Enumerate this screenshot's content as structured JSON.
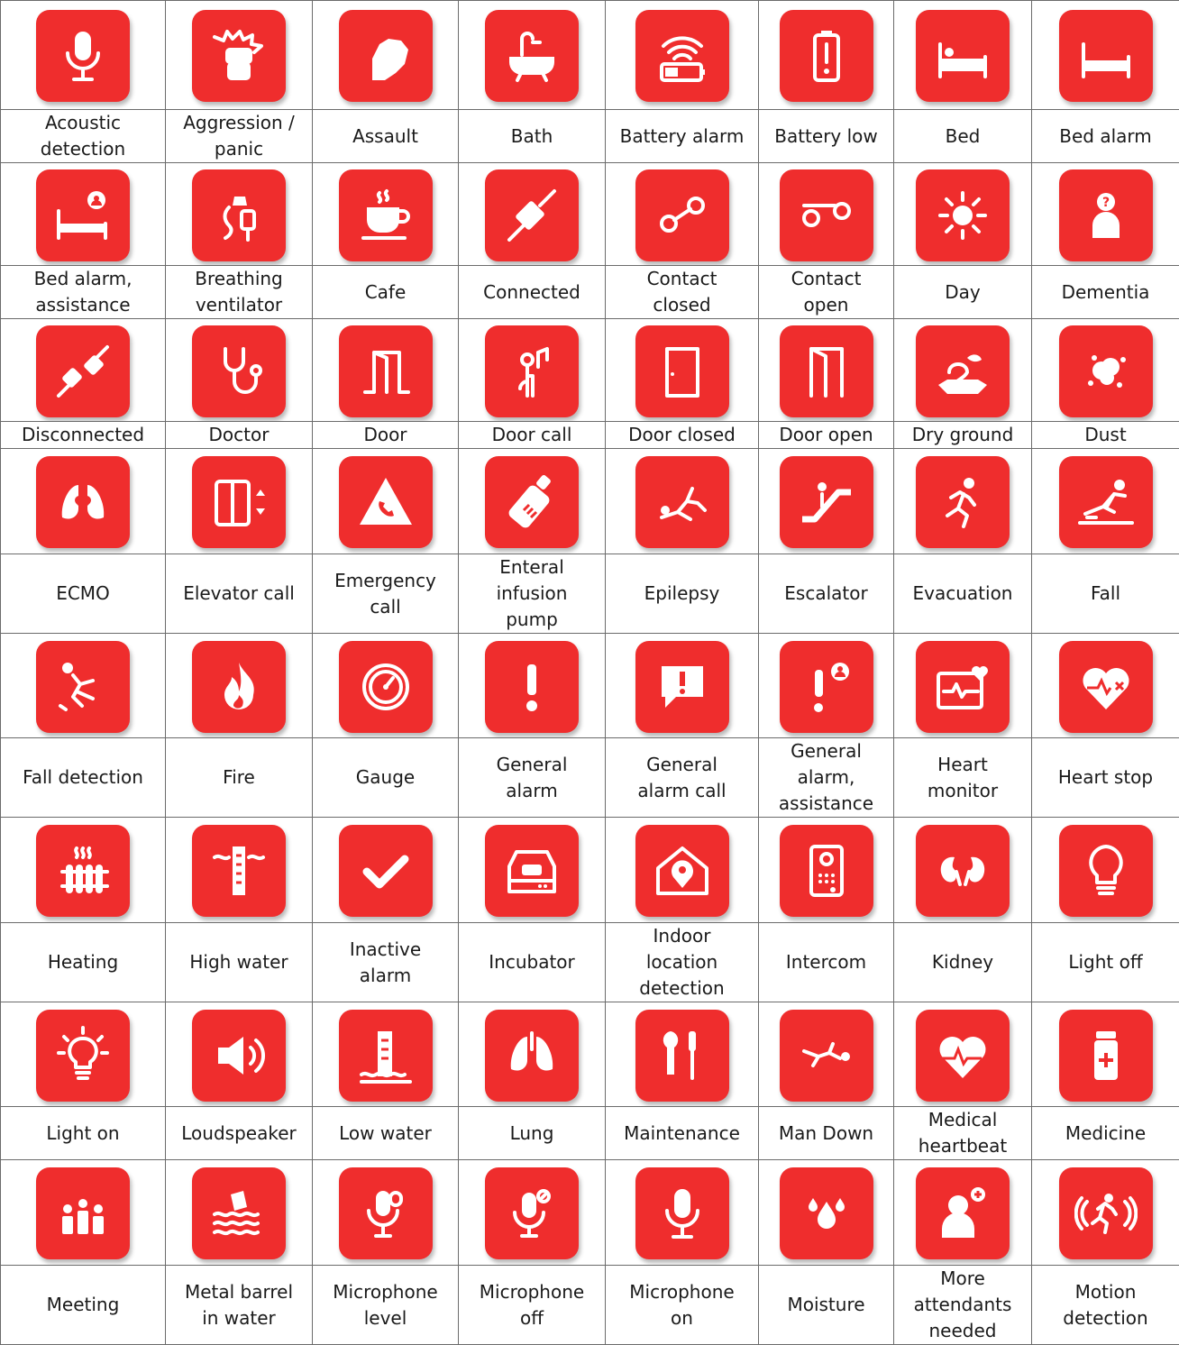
{
  "theme": {
    "tile_color": "#ef2d2d",
    "glyph_color": "#ffffff",
    "border_color": "#6b6b6b"
  },
  "rows": [
    {
      "items": [
        {
          "label": "Acoustic\ndetection",
          "icon": "microphone-icon"
        },
        {
          "label": "Aggression /\npanic",
          "icon": "fist-burst-icon"
        },
        {
          "label": "Assault",
          "icon": "fist-icon"
        },
        {
          "label": "Bath",
          "icon": "bathtub-icon"
        },
        {
          "label": "Battery alarm",
          "icon": "battery-wireless-icon"
        },
        {
          "label": "Battery low",
          "icon": "battery-exclamation-icon"
        },
        {
          "label": "Bed",
          "icon": "bed-person-icon"
        },
        {
          "label": "Bed alarm",
          "icon": "bed-icon"
        }
      ]
    },
    {
      "items": [
        {
          "label": "Bed alarm,\nassistance",
          "icon": "bed-assistance-icon"
        },
        {
          "label": "Breathing\nventilator",
          "icon": "ventilator-icon"
        },
        {
          "label": "Cafe",
          "icon": "coffee-cup-icon"
        },
        {
          "label": "Connected",
          "icon": "plug-connected-icon"
        },
        {
          "label": "Contact\nclosed",
          "icon": "contact-closed-icon"
        },
        {
          "label": "Contact\nopen",
          "icon": "contact-open-icon"
        },
        {
          "label": "Day",
          "icon": "sun-icon"
        },
        {
          "label": "Dementia",
          "icon": "person-question-icon"
        }
      ]
    },
    {
      "items": [
        {
          "label": "Disconnected",
          "icon": "plug-disconnected-icon"
        },
        {
          "label": "Doctor",
          "icon": "stethoscope-icon"
        },
        {
          "label": "Door",
          "icon": "door-icon"
        },
        {
          "label": "Door call",
          "icon": "door-call-icon"
        },
        {
          "label": "Door closed",
          "icon": "door-closed-icon"
        },
        {
          "label": "Door open",
          "icon": "door-open-icon"
        },
        {
          "label": "Dry ground",
          "icon": "dry-ground-icon"
        },
        {
          "label": "Dust",
          "icon": "dust-icon"
        }
      ]
    },
    {
      "items": [
        {
          "label": "ECMO",
          "icon": "lungs-heart-icon"
        },
        {
          "label": "Elevator call",
          "icon": "elevator-icon"
        },
        {
          "label": "Emergency\ncall",
          "icon": "phone-triangle-icon"
        },
        {
          "label": "Enteral\ninfusion\npump",
          "icon": "bottle-icon"
        },
        {
          "label": "Epilepsy",
          "icon": "seizure-icon"
        },
        {
          "label": "Escalator",
          "icon": "escalator-icon"
        },
        {
          "label": "Evacuation",
          "icon": "running-person-icon"
        },
        {
          "label": "Fall",
          "icon": "slipping-person-icon"
        }
      ]
    },
    {
      "items": [
        {
          "label": "Fall detection",
          "icon": "falling-person-icon"
        },
        {
          "label": "Fire",
          "icon": "fire-icon"
        },
        {
          "label": "Gauge",
          "icon": "gauge-icon"
        },
        {
          "label": "General\nalarm",
          "icon": "exclamation-icon"
        },
        {
          "label": "General\nalarm call",
          "icon": "exclamation-bubble-icon"
        },
        {
          "label": "General\nalarm,\nassistance",
          "icon": "exclamation-person-icon"
        },
        {
          "label": "Heart\nmonitor",
          "icon": "heart-monitor-icon"
        },
        {
          "label": "Heart stop",
          "icon": "heart-stop-icon"
        }
      ]
    },
    {
      "items": [
        {
          "label": "Heating",
          "icon": "radiator-icon"
        },
        {
          "label": "High water",
          "icon": "high-water-icon"
        },
        {
          "label": "Inactive\nalarm",
          "icon": "checkmark-icon"
        },
        {
          "label": "Incubator",
          "icon": "incubator-icon"
        },
        {
          "label": "Indoor\nlocation\ndetection",
          "icon": "house-pin-icon"
        },
        {
          "label": "Intercom",
          "icon": "intercom-icon"
        },
        {
          "label": "Kidney",
          "icon": "kidneys-icon"
        },
        {
          "label": "Light off",
          "icon": "bulb-off-icon"
        }
      ]
    },
    {
      "items": [
        {
          "label": "Light on",
          "icon": "bulb-on-icon"
        },
        {
          "label": "Loudspeaker",
          "icon": "speaker-icon"
        },
        {
          "label": "Low water",
          "icon": "low-water-icon"
        },
        {
          "label": "Lung",
          "icon": "lungs-icon"
        },
        {
          "label": "Maintenance",
          "icon": "tools-icon"
        },
        {
          "label": "Man Down",
          "icon": "man-down-icon"
        },
        {
          "label": "Medical\nheartbeat",
          "icon": "heartbeat-icon"
        },
        {
          "label": "Medicine",
          "icon": "pill-bottle-icon"
        }
      ]
    },
    {
      "items": [
        {
          "label": "Meeting",
          "icon": "meeting-icon"
        },
        {
          "label": "Metal barrel\nin water",
          "icon": "barrel-water-icon"
        },
        {
          "label": "Microphone\nlevel",
          "icon": "microphone-level-icon"
        },
        {
          "label": "Microphone\noff",
          "icon": "microphone-off-icon"
        },
        {
          "label": "Microphone\non",
          "icon": "microphone-on-icon"
        },
        {
          "label": "Moisture",
          "icon": "droplets-icon"
        },
        {
          "label": "More\nattendants\nneeded",
          "icon": "person-plus-icon"
        },
        {
          "label": "Motion\ndetection",
          "icon": "motion-icon"
        }
      ]
    }
  ]
}
